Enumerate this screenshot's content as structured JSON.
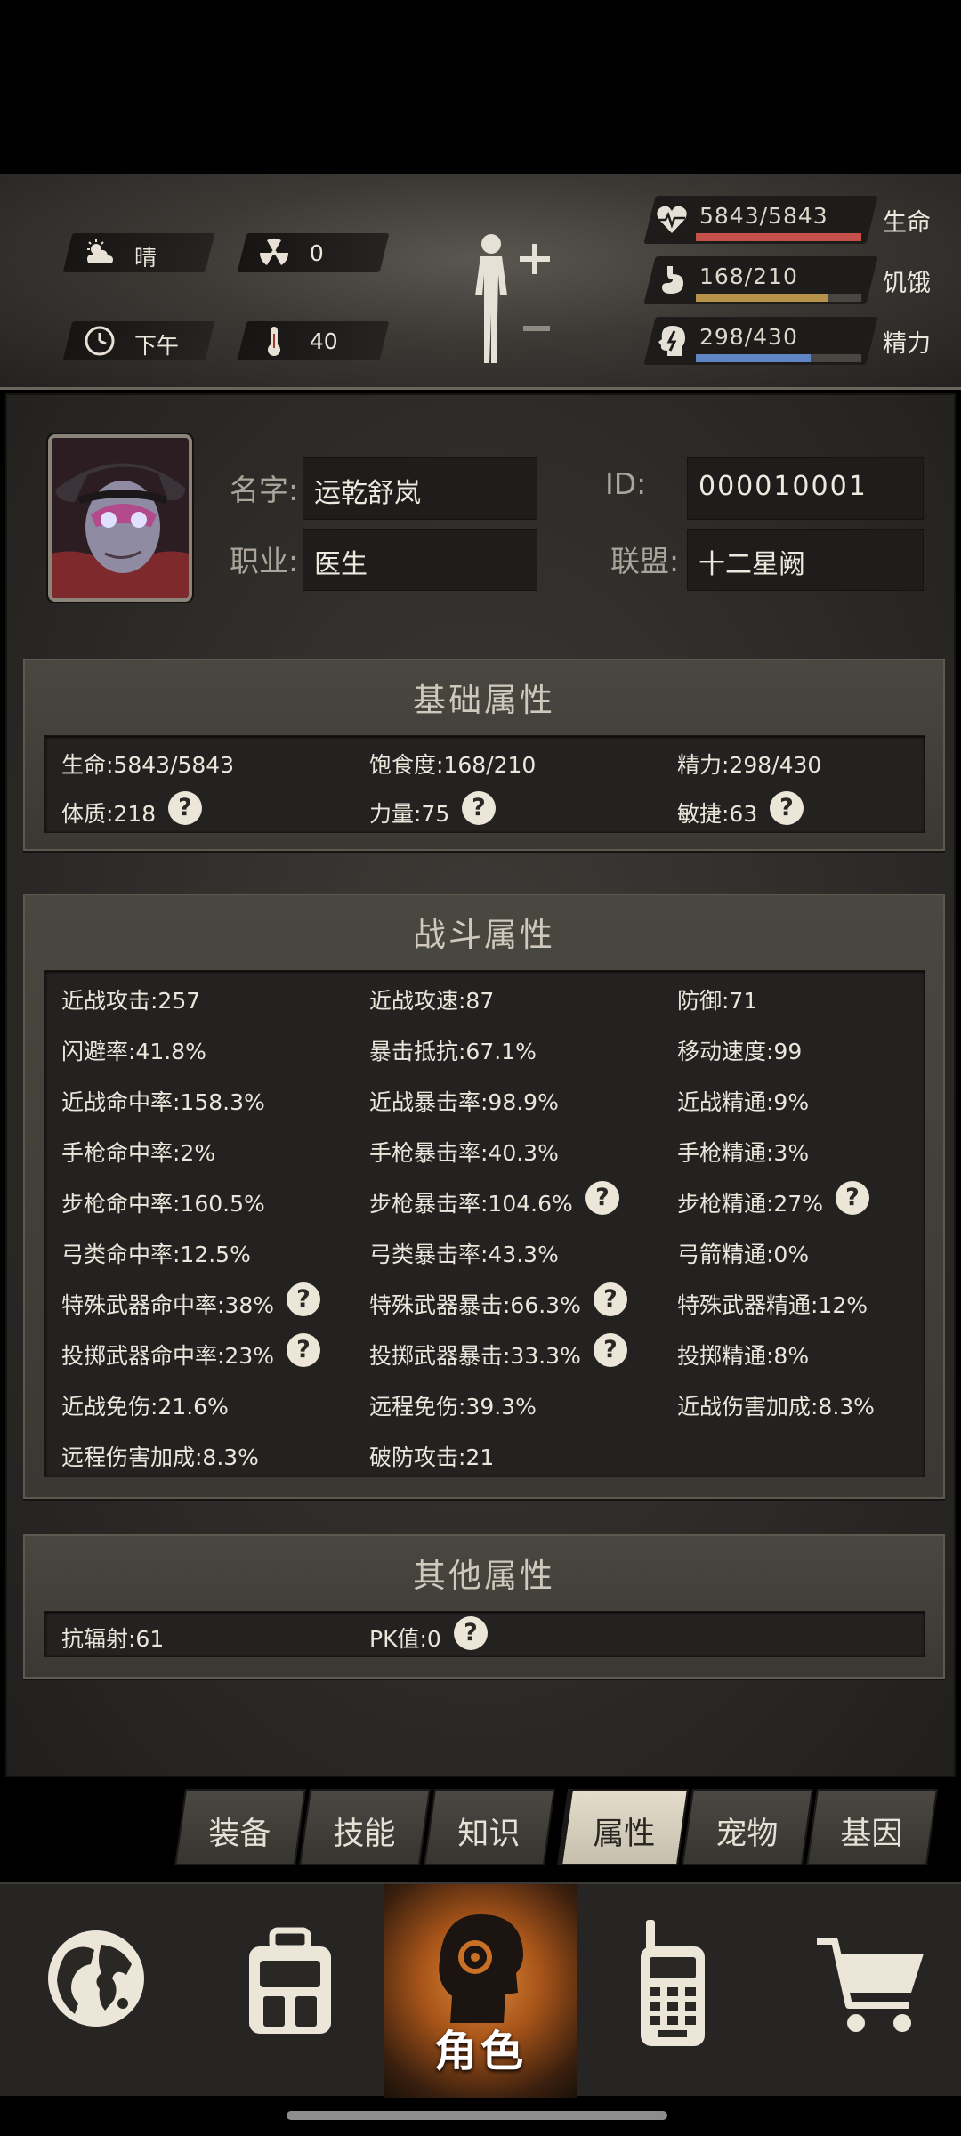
{
  "hud": {
    "weather": "晴",
    "radiation": "0",
    "time_of_day": "下午",
    "temperature": "40",
    "bars": [
      {
        "icon": "heart-pulse-icon",
        "value": "5843/5843",
        "label": "生命",
        "fraction": 1.0,
        "color": "#c5504a"
      },
      {
        "icon": "stomach-icon",
        "value": "168/210",
        "label": "饥饿",
        "fraction": 0.8,
        "color": "#b7924a"
      },
      {
        "icon": "energy-head-icon",
        "value": "298/430",
        "label": "精力",
        "fraction": 0.693,
        "color": "#5f86c4"
      }
    ]
  },
  "profile": {
    "name_label": "名字:",
    "name": "运乾舒岚",
    "id_label": "ID:",
    "id": "000010001",
    "job_label": "职业:",
    "job": "医生",
    "alliance_label": "联盟:",
    "alliance": "十二星阙"
  },
  "basic": {
    "title": "基础属性",
    "stats": [
      {
        "text": "生命:5843/5843",
        "help": false
      },
      {
        "text": "饱食度:168/210",
        "help": false
      },
      {
        "text": "精力:298/430",
        "help": false
      },
      {
        "text": "体质:218",
        "help": true
      },
      {
        "text": "力量:75",
        "help": true
      },
      {
        "text": "敏捷:63",
        "help": true
      }
    ]
  },
  "combat": {
    "title": "战斗属性",
    "stats": [
      {
        "text": "近战攻击:257",
        "help": false
      },
      {
        "text": "近战攻速:87",
        "help": false
      },
      {
        "text": "防御:71",
        "help": false
      },
      {
        "text": "闪避率:41.8%",
        "help": false
      },
      {
        "text": "暴击抵抗:67.1%",
        "help": false
      },
      {
        "text": "移动速度:99",
        "help": false
      },
      {
        "text": "近战命中率:158.3%",
        "help": false
      },
      {
        "text": "近战暴击率:98.9%",
        "help": false
      },
      {
        "text": "近战精通:9%",
        "help": false
      },
      {
        "text": "手枪命中率:2%",
        "help": false
      },
      {
        "text": "手枪暴击率:40.3%",
        "help": false
      },
      {
        "text": "手枪精通:3%",
        "help": false
      },
      {
        "text": "步枪命中率:160.5%",
        "help": false
      },
      {
        "text": "步枪暴击率:104.6%",
        "help": true
      },
      {
        "text": "步枪精通:27%",
        "help": true
      },
      {
        "text": "弓类命中率:12.5%",
        "help": false
      },
      {
        "text": "弓类暴击率:43.3%",
        "help": false
      },
      {
        "text": "弓箭精通:0%",
        "help": false
      },
      {
        "text": "特殊武器命中率:38%",
        "help": true
      },
      {
        "text": "特殊武器暴击:66.3%",
        "help": true
      },
      {
        "text": "特殊武器精通:12%",
        "help": false
      },
      {
        "text": "投掷武器命中率:23%",
        "help": true
      },
      {
        "text": "投掷武器暴击:33.3%",
        "help": true
      },
      {
        "text": "投掷精通:8%",
        "help": false
      },
      {
        "text": "近战免伤:21.6%",
        "help": false
      },
      {
        "text": "远程免伤:39.3%",
        "help": false
      },
      {
        "text": "近战伤害加成:8.3%",
        "help": false
      },
      {
        "text": "远程伤害加成:8.3%",
        "help": false
      },
      {
        "text": "破防攻击:21",
        "help": false
      }
    ]
  },
  "other": {
    "title": "其他属性",
    "stats": [
      {
        "text": "抗辐射:61",
        "help": false
      },
      {
        "text": "PK值:0",
        "help": true
      }
    ]
  },
  "help_glyph": "?",
  "tabs": [
    "装备",
    "技能",
    "知识",
    "属性",
    "宠物",
    "基因"
  ],
  "active_tab": "属性",
  "nav": {
    "items": [
      "world-map",
      "backpack",
      "character",
      "radio",
      "shop"
    ],
    "active_label": "角色"
  }
}
